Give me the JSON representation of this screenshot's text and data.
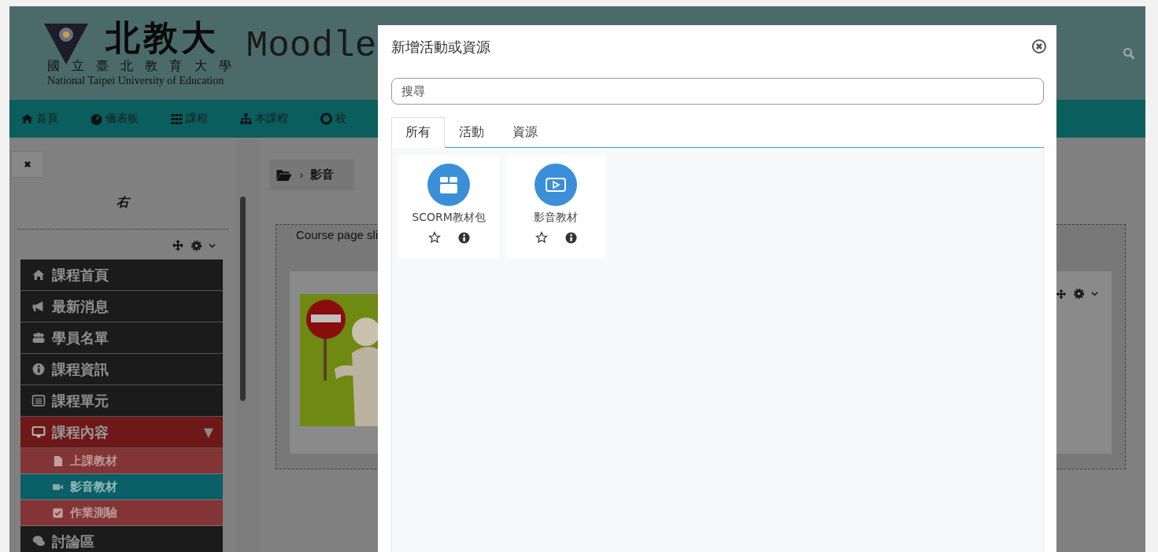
{
  "header": {
    "logo_title": "北教大",
    "logo_subtitle": "國 立 臺 北 教 育 大 學",
    "logo_english": "National Taipei University of Education",
    "site_name": "Moodle"
  },
  "nav": [
    {
      "label": "首頁"
    },
    {
      "label": "儀表板"
    },
    {
      "label": "課程"
    },
    {
      "label": "本課程"
    },
    {
      "label": "校"
    }
  ],
  "sidebar": {
    "block_title": "右",
    "menu": [
      {
        "label": "課程首頁",
        "selected": false
      },
      {
        "label": "最新消息",
        "selected": false
      },
      {
        "label": "學員名單",
        "selected": false
      },
      {
        "label": "課程資訊",
        "selected": false
      },
      {
        "label": "課程單元",
        "selected": false
      },
      {
        "label": "課程內容",
        "selected": true,
        "expanded": true,
        "toggle": "▼",
        "children": [
          {
            "label": "上課教材",
            "selected": false
          },
          {
            "label": "影音教材",
            "selected": true
          },
          {
            "label": "作業測驗",
            "selected": false
          }
        ]
      },
      {
        "label": "討論區",
        "selected": false
      }
    ]
  },
  "breadcrumb": {
    "separator": "›",
    "current": "影音"
  },
  "main": {
    "block_text": "Course page sli"
  },
  "modal": {
    "title": "新增活動或資源",
    "search": {
      "placeholder": "搜尋"
    },
    "tabs": [
      {
        "label": "所有",
        "selected": true
      },
      {
        "label": "活動",
        "selected": false
      },
      {
        "label": "資源",
        "selected": false
      }
    ],
    "items": [
      {
        "name": "SCORM教材包",
        "starred": false
      },
      {
        "name": "影音教材",
        "starred": false
      }
    ]
  }
}
